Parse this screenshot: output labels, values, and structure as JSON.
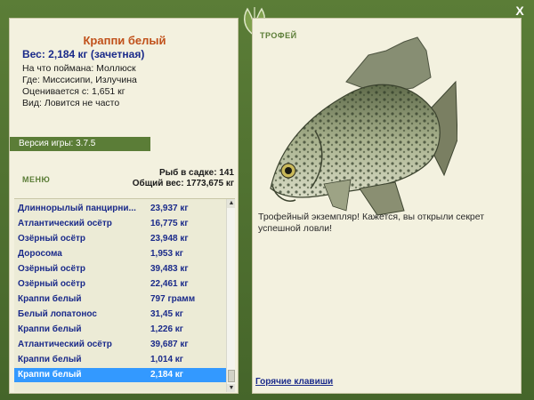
{
  "window": {
    "close_label": "X"
  },
  "catch_info": {
    "fish_name": "Краппи белый",
    "weight_line": "Вес: 2,184 кг (зачетная)",
    "lines": [
      "На что поймана: Моллюск",
      "Где: Миссисипи, Излучина",
      "Оценивается с: 1,651 кг",
      "Вид: Ловится не часто"
    ]
  },
  "version": "Версия игры: 3.7.5",
  "menu_label": "МЕНЮ",
  "totals": {
    "count_line": "Рыб в садке: 141",
    "weight_line": "Общий вес: 1773,675 кг"
  },
  "catch_list": [
    {
      "name": "Длиннорылый панцирни...",
      "weight": "23,937 кг"
    },
    {
      "name": "Атлантический осётр",
      "weight": "16,775 кг"
    },
    {
      "name": "Озёрный осётр",
      "weight": "23,948 кг"
    },
    {
      "name": "Доросома",
      "weight": "1,953 кг"
    },
    {
      "name": "Озёрный осётр",
      "weight": "39,483 кг"
    },
    {
      "name": "Озёрный осётр",
      "weight": "22,461 кг"
    },
    {
      "name": "Краппи белый",
      "weight": "797 грамм"
    },
    {
      "name": "Белый лопатонос",
      "weight": "31,45 кг"
    },
    {
      "name": "Краппи белый",
      "weight": "1,226 кг"
    },
    {
      "name": "Атлантический осётр",
      "weight": "39,687 кг"
    },
    {
      "name": "Краппи белый",
      "weight": "1,014 кг"
    },
    {
      "name": "Краппи белый",
      "weight": "2,184 кг",
      "selected": true
    }
  ],
  "trophy": {
    "label": "ТРОФЕЙ",
    "text": "Трофейный экземпляр! Кажется, вы открыли секрет успешной ловли!"
  },
  "hotkeys_label": "Горячие клавиши",
  "colors": {
    "frame": "#5b7d37",
    "panel": "#f3f1df",
    "fish_name": "#c0501a",
    "list_text": "#1a2a8a",
    "selection": "#3399ff"
  }
}
